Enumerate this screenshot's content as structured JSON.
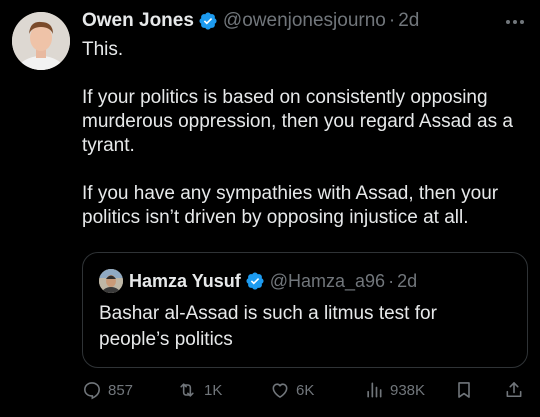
{
  "tweet": {
    "author_name": "Owen Jones",
    "author_handle": "@owenjonesjourno",
    "separator": "·",
    "time": "2d",
    "paragraphs": [
      "This.",
      "If your politics is based on consistently opposing murderous oppression, then you regard Assad as a tyrant.",
      "If you have any sympathies with Assad, then your politics isn’t driven by opposing injustice at all."
    ]
  },
  "quoted_tweet": {
    "author_name": "Hamza Yusuf",
    "author_handle": "@Hamza_a96",
    "separator": "·",
    "time": "2d",
    "text": "Bashar al-Assad is such a litmus test for people’s politics"
  },
  "actions": {
    "replies": "857",
    "reposts": "1K",
    "likes": "6K",
    "views": "938K"
  },
  "colors": {
    "background": "#000000",
    "text_primary": "#e7e9ea",
    "text_secondary": "#71767b",
    "verified_blue": "#1d9bf0",
    "border": "#2f3336"
  },
  "icons": {
    "verified": "verified-badge-icon",
    "more": "more-horizontal-icon",
    "reply": "reply-icon",
    "repost": "repost-icon",
    "like": "heart-icon",
    "views": "views-icon",
    "bookmark": "bookmark-icon",
    "share": "share-icon"
  }
}
